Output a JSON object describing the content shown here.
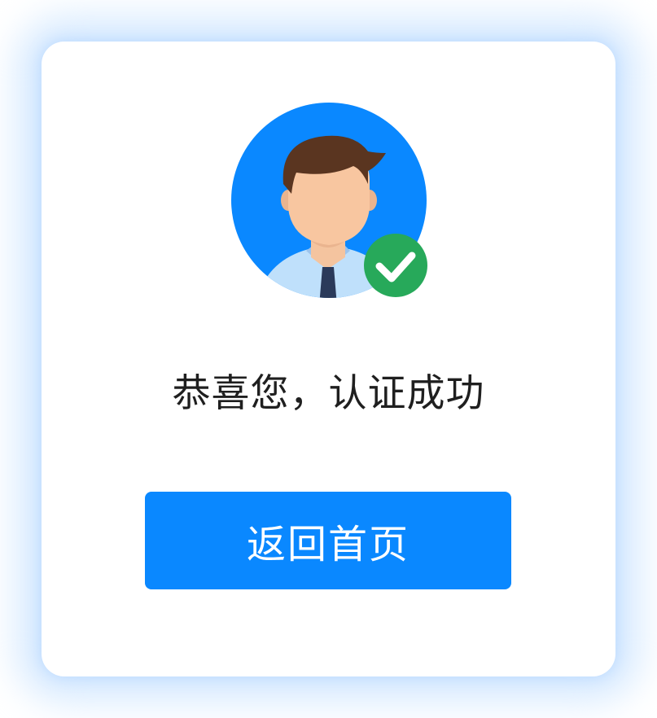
{
  "result": {
    "title": "恭喜您，认证成功",
    "status": "success"
  },
  "actions": {
    "home_label": "返回首页"
  },
  "icons": {
    "avatar": "user-avatar-icon",
    "badge": "check-badge-icon"
  },
  "colors": {
    "primary": "#0a88ff",
    "success": "#27a95a",
    "avatar_bg": "#0a88ff"
  }
}
